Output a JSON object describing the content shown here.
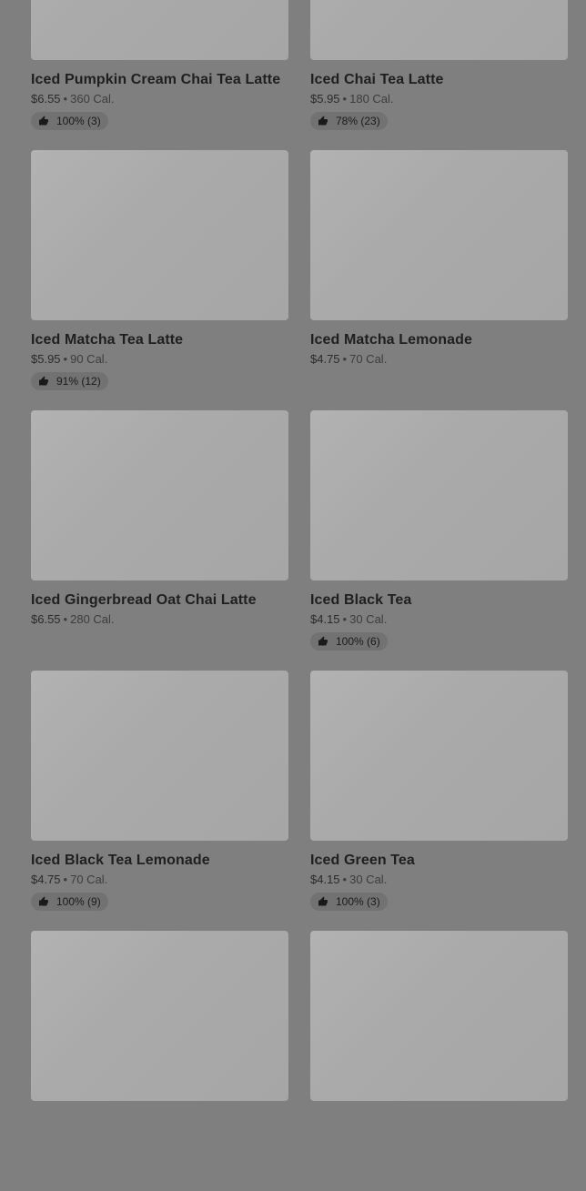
{
  "menu": {
    "items": [
      {
        "name": "Iced Pumpkin Cream Chai Tea Latte",
        "price": "$6.55",
        "separator": "•",
        "calories": "360 Cal.",
        "rating": "100% (3)"
      },
      {
        "name": "Iced Chai Tea Latte",
        "price": "$5.95",
        "separator": "•",
        "calories": "180 Cal.",
        "rating": "78% (23)"
      },
      {
        "name": "Iced Matcha Tea Latte",
        "price": "$5.95",
        "separator": "•",
        "calories": "90 Cal.",
        "rating": "91% (12)"
      },
      {
        "name": "Iced Matcha Lemonade",
        "price": "$4.75",
        "separator": "•",
        "calories": "70 Cal.",
        "rating": null
      },
      {
        "name": "Iced Gingerbread Oat Chai Latte",
        "price": "$6.55",
        "separator": "•",
        "calories": "280 Cal.",
        "rating": null
      },
      {
        "name": "Iced Black Tea",
        "price": "$4.15",
        "separator": "•",
        "calories": "30 Cal.",
        "rating": "100% (6)"
      },
      {
        "name": "Iced Black Tea Lemonade",
        "price": "$4.75",
        "separator": "•",
        "calories": "70 Cal.",
        "rating": "100% (9)"
      },
      {
        "name": "Iced Green Tea",
        "price": "$4.15",
        "separator": "•",
        "calories": "30 Cal.",
        "rating": "100% (3)"
      }
    ],
    "rating_icon": "thumbs-up-icon",
    "colors": {
      "overlay_background": "#7f7f7f",
      "thumbnail_placeholder": "#aaaaaa",
      "rating_pill": "#727272",
      "text": "#1f1f1f"
    }
  }
}
